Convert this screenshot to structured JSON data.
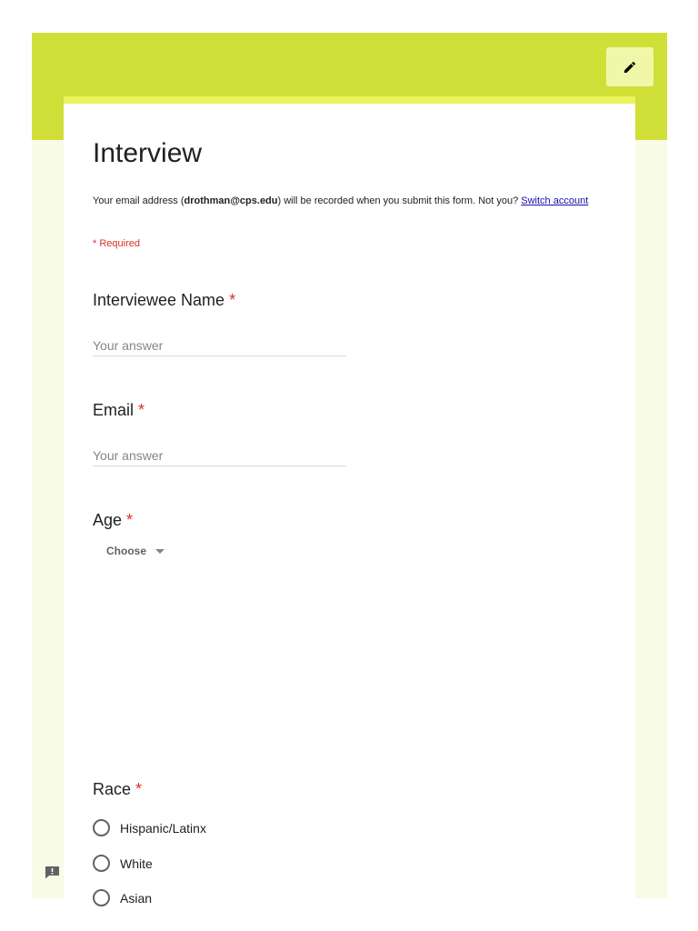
{
  "colors": {
    "header_band": "#d0df38",
    "edit_button_bg": "#eff7a8",
    "page_bg": "#f8fbe6",
    "card_accent": "#eaf35a",
    "required": "#d93025",
    "link": "#1a0dab"
  },
  "header": {
    "edit_icon": "pencil-icon"
  },
  "form": {
    "title": "Interview",
    "email_notice": {
      "prefix": "Your email address (",
      "email": "drothman@cps.edu",
      "suffix": ") will be recorded when you submit this form. Not you? ",
      "switch_link": "Switch account"
    },
    "required_note": "* Required",
    "questions": {
      "interviewee_name": {
        "label": "Interviewee Name",
        "required_mark": "*",
        "placeholder": "Your answer"
      },
      "email": {
        "label": "Email",
        "required_mark": "*",
        "placeholder": "Your answer"
      },
      "age": {
        "label": "Age",
        "required_mark": "*",
        "dropdown_value": "Choose"
      },
      "race": {
        "label": "Race",
        "required_mark": "*",
        "options": [
          "Hispanic/Latinx",
          "White",
          "Asian"
        ]
      }
    }
  },
  "footer": {
    "feedback_icon": "report-feedback-icon"
  }
}
